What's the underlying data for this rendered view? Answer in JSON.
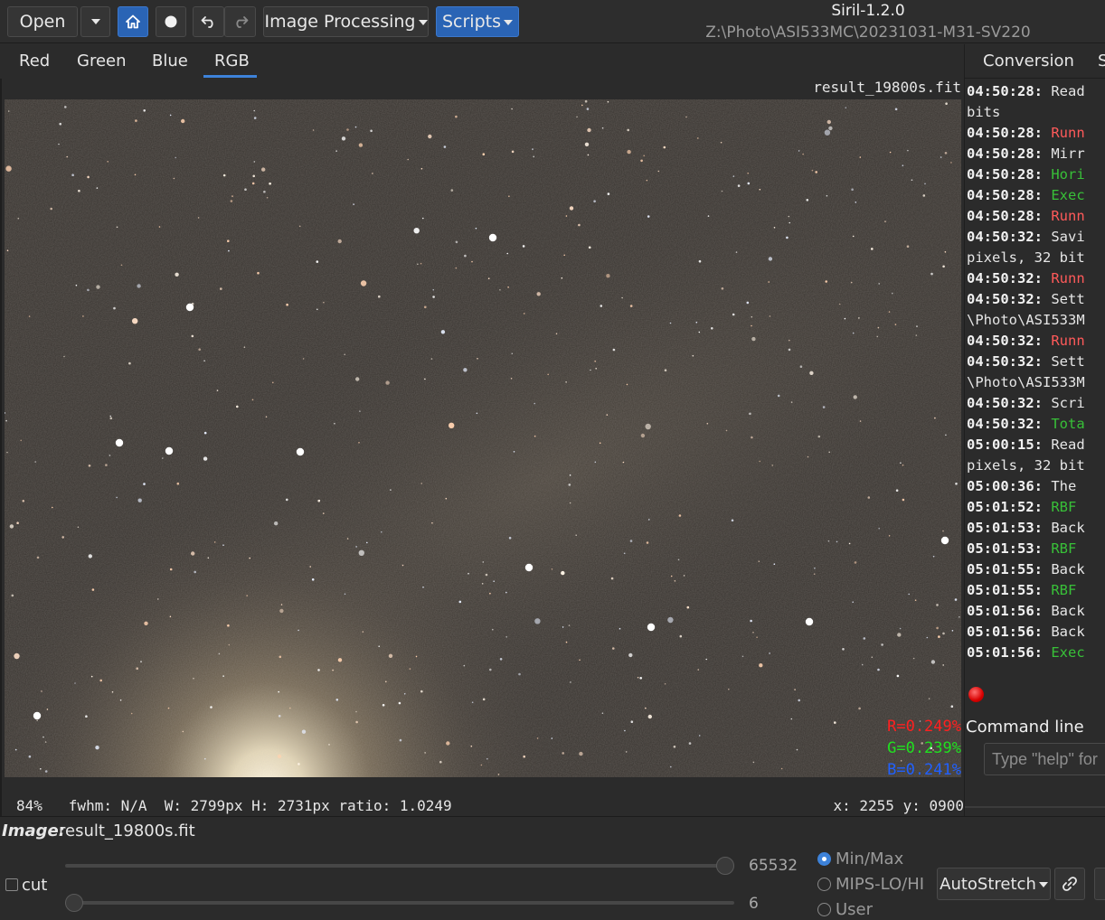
{
  "toolbar": {
    "open_label": "Open",
    "image_processing_label": "Image Processing",
    "scripts_label": "Scripts",
    "icons": [
      "chevron-down-icon",
      "home-icon",
      "record-icon",
      "undo-icon",
      "redo-icon"
    ]
  },
  "window": {
    "title": "Siril-1.2.0",
    "path": "Z:\\Photo\\ASI533MC\\20231031-M31-SV220"
  },
  "channel_tabs": [
    "Red",
    "Green",
    "Blue",
    "RGB"
  ],
  "active_tab": "RGB",
  "viewer": {
    "filename": "result_19800s.fit",
    "rgb": {
      "r": "R=0.249%",
      "g": "G=0.239%",
      "b": "B=0.241%"
    },
    "status_left": "84%   fwhm: N/A  W: 2799px H: 2731px ratio: 1.0249",
    "status_right": "x: 2255 y: 0900"
  },
  "right_panel": {
    "tabs": [
      "Conversion",
      "S"
    ],
    "log": [
      {
        "time": "04:50:28:",
        "text": "Read",
        "color": "white"
      },
      {
        "time": "",
        "text": "bits",
        "color": "white"
      },
      {
        "time": "04:50:28:",
        "text": "Runn",
        "color": "red"
      },
      {
        "time": "04:50:28:",
        "text": "Mirr",
        "color": "white"
      },
      {
        "time": "04:50:28:",
        "text": "Hori",
        "color": "green"
      },
      {
        "time": "04:50:28:",
        "text": "Exec",
        "color": "green"
      },
      {
        "time": "04:50:28:",
        "text": "Runn",
        "color": "red"
      },
      {
        "time": "04:50:32:",
        "text": "Savi",
        "color": "white"
      },
      {
        "time": "",
        "text": "pixels, 32 bit",
        "color": "white"
      },
      {
        "time": "04:50:32:",
        "text": "Runn",
        "color": "red"
      },
      {
        "time": "04:50:32:",
        "text": "Sett",
        "color": "white"
      },
      {
        "time": "",
        "text": "\\Photo\\ASI533M",
        "color": "white"
      },
      {
        "time": "04:50:32:",
        "text": "Runn",
        "color": "red"
      },
      {
        "time": "04:50:32:",
        "text": "Sett",
        "color": "white"
      },
      {
        "time": "",
        "text": "\\Photo\\ASI533M",
        "color": "white"
      },
      {
        "time": "04:50:32:",
        "text": "Scri",
        "color": "white"
      },
      {
        "time": "04:50:32:",
        "text": "Tota",
        "color": "green"
      },
      {
        "time": "05:00:15:",
        "text": "Read",
        "color": "white"
      },
      {
        "time": "",
        "text": "pixels, 32 bit",
        "color": "white"
      },
      {
        "time": "05:00:36:",
        "text": "The",
        "color": "white"
      },
      {
        "time": "05:01:52:",
        "text": "RBF",
        "color": "green"
      },
      {
        "time": "05:01:53:",
        "text": "Back",
        "color": "white"
      },
      {
        "time": "05:01:53:",
        "text": "RBF",
        "color": "green"
      },
      {
        "time": "05:01:55:",
        "text": "Back",
        "color": "white"
      },
      {
        "time": "05:01:55:",
        "text": "RBF",
        "color": "green"
      },
      {
        "time": "05:01:56:",
        "text": "Back",
        "color": "white"
      },
      {
        "time": "05:01:56:",
        "text": "Back",
        "color": "white"
      },
      {
        "time": "05:01:56:",
        "text": "Exec",
        "color": "green"
      }
    ],
    "command_label": "Command line",
    "command_placeholder": "Type \"help\" for"
  },
  "bottom": {
    "image_label": "Image:",
    "image_name": "result_19800s.fit",
    "cut_label": "cut",
    "high_value": "65532",
    "low_value": "6",
    "high_fraction": 1.0,
    "low_fraction": 0.0,
    "modes": [
      "Min/Max",
      "MIPS-LO/HI",
      "User"
    ],
    "selected_mode": "Min/Max",
    "stretch_label": "AutoStretch",
    "link_icon": "link-icon"
  },
  "colors": {
    "accent": "#2a64b5",
    "log_red": "#ff5a5a",
    "log_green": "#38c038",
    "rgb_r": "#ff2020",
    "rgb_g": "#20e020",
    "rgb_b": "#2060ff"
  }
}
